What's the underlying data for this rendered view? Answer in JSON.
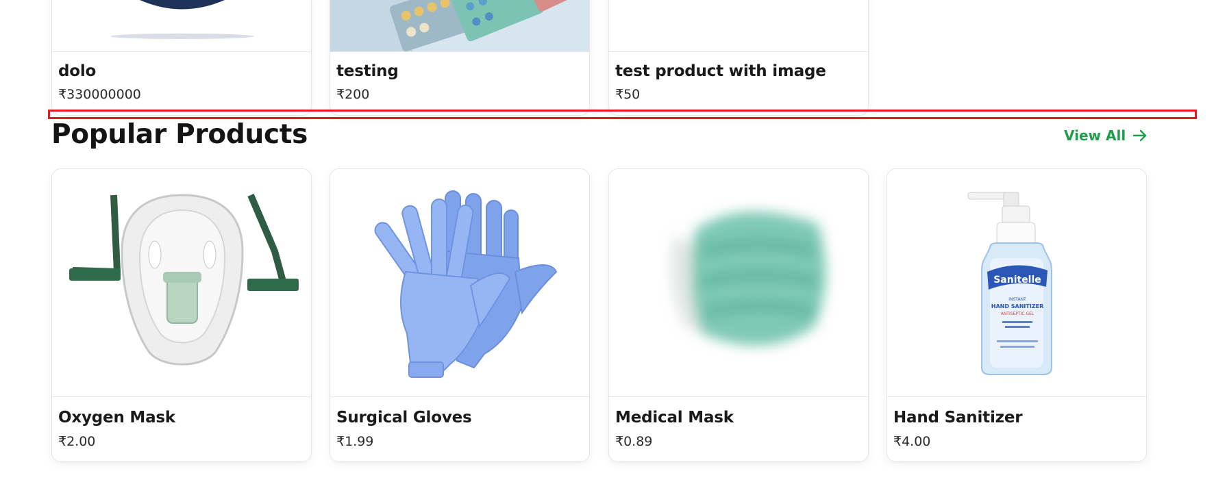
{
  "top_products": [
    {
      "name": "dolo",
      "price": "₹330000000"
    },
    {
      "name": "testing",
      "price": "₹200"
    },
    {
      "name": "test product with image",
      "price": "₹50"
    }
  ],
  "popular": {
    "title": "Popular Products",
    "view_all_label": "View All",
    "products": [
      {
        "name": "Oxygen Mask",
        "price": "₹2.00"
      },
      {
        "name": "Surgical Gloves",
        "price": "₹1.99"
      },
      {
        "name": "Medical Mask",
        "price": "₹0.89"
      },
      {
        "name": "Hand Sanitizer",
        "price": "₹4.00"
      }
    ]
  },
  "sanitizer_label": {
    "brand": "Sanitelle",
    "line1": "INSTANT",
    "line2": "HAND SANITIZER",
    "line3": "ANTISEPTIC GEL"
  },
  "colors": {
    "accent": "#1f9d4c",
    "highlight": "#e01b24"
  }
}
